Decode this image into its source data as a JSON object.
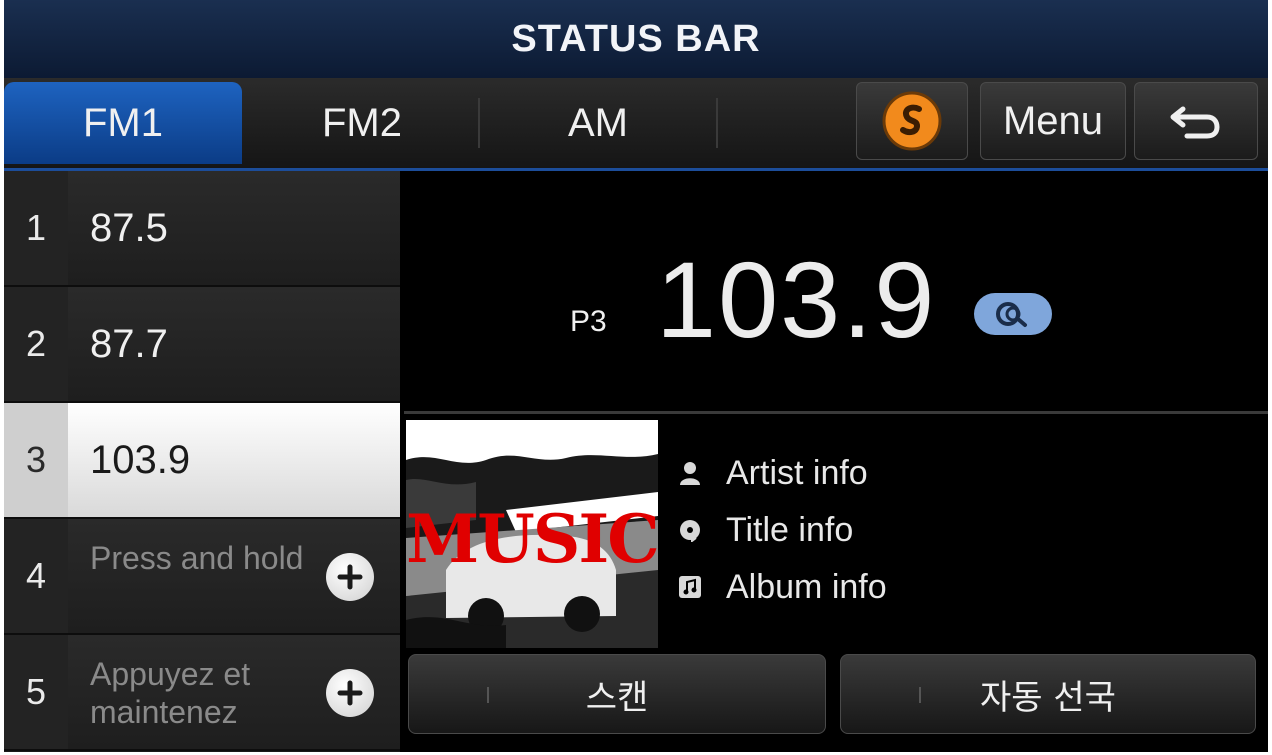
{
  "status_bar": {
    "title": "STATUS BAR"
  },
  "tabs": [
    {
      "label": "FM1",
      "active": true
    },
    {
      "label": "FM2",
      "active": false
    },
    {
      "label": "AM",
      "active": false
    }
  ],
  "toolbar": {
    "soundhound_icon": "soundhound-icon",
    "menu_label": "Menu",
    "back_icon": "back-arrow-icon"
  },
  "presets": [
    {
      "number": "1",
      "frequency": "87.5"
    },
    {
      "number": "2",
      "frequency": "87.7"
    },
    {
      "number": "3",
      "frequency": "103.9",
      "selected": true
    },
    {
      "number": "4",
      "hint": "Press and hold"
    },
    {
      "number": "5",
      "hint": "Appuyez et maintenez"
    }
  ],
  "now_playing": {
    "preset_label": "P3",
    "frequency": "103.9",
    "album_overlay_text": "MUSIC",
    "artist": "Artist info",
    "title": "Title info",
    "album": "Album info"
  },
  "actions": {
    "scan_label": "스캔",
    "auto_store_label": "자동 선국"
  },
  "colors": {
    "status_bar_bg": "#12284a",
    "active_tab": "#1a5bb5",
    "accent_orange": "#f28a1c",
    "search_badge": "#7fa6db"
  }
}
